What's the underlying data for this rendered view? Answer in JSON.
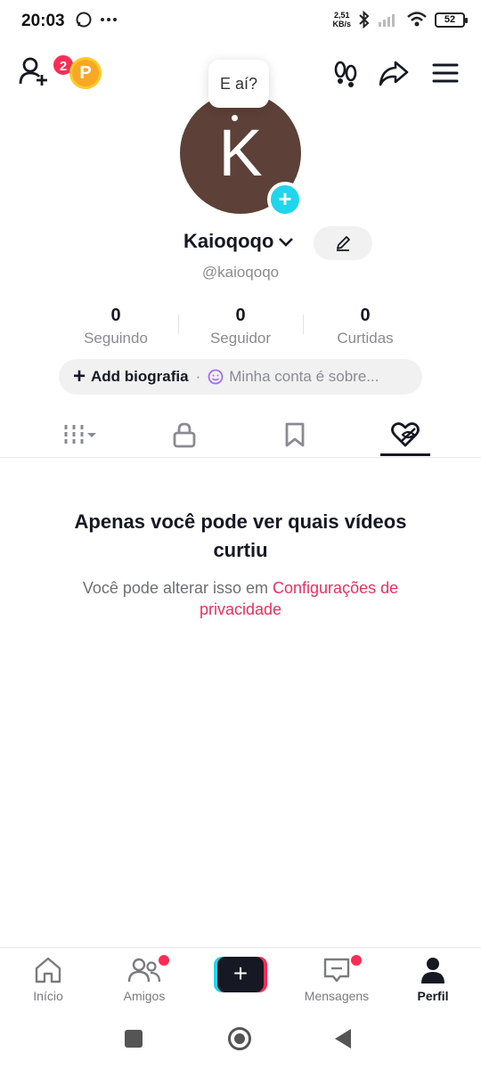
{
  "status_bar": {
    "time": "20:03",
    "speed_value": "2,51",
    "speed_unit": "KB/s",
    "battery": "52"
  },
  "top_bar": {
    "friend_badge_count": "2",
    "coin_label": "P"
  },
  "profile": {
    "avatar_letter": "K",
    "bubble_text": "E aí?",
    "display_name": "Kaioqoqo",
    "username": "@kaioqoqo"
  },
  "stats": [
    {
      "value": "0",
      "label": "Seguindo"
    },
    {
      "value": "0",
      "label": "Seguidor"
    },
    {
      "value": "0",
      "label": "Curtidas"
    }
  ],
  "bio": {
    "add_label": "Add biografia",
    "separator": "·",
    "hint": "Minha conta é sobre..."
  },
  "tabs": [
    {
      "icon": "grid-icon",
      "active": false
    },
    {
      "icon": "lock-icon",
      "active": false
    },
    {
      "icon": "bookmark-icon",
      "active": false
    },
    {
      "icon": "liked-heart-hidden-icon",
      "active": true
    }
  ],
  "empty_state": {
    "title": "Apenas você pode ver quais vídeos curtiu",
    "subtitle_prefix": "Você pode alterar isso em",
    "link_text": "Configurações de privacidade"
  },
  "bottom_nav": {
    "items": [
      {
        "label": "Início",
        "icon": "home-icon"
      },
      {
        "label": "Amigos",
        "icon": "friends-icon"
      },
      {
        "label": "",
        "icon": "create-plus-icon"
      },
      {
        "label": "Mensagens",
        "icon": "inbox-icon"
      },
      {
        "label": "Perfil",
        "icon": "profile-icon"
      }
    ]
  },
  "colors": {
    "accent_red": "#fe2c55",
    "accent_cyan": "#20d5ec",
    "link_pink": "#e8315a",
    "avatar_bg": "#5d4037"
  }
}
